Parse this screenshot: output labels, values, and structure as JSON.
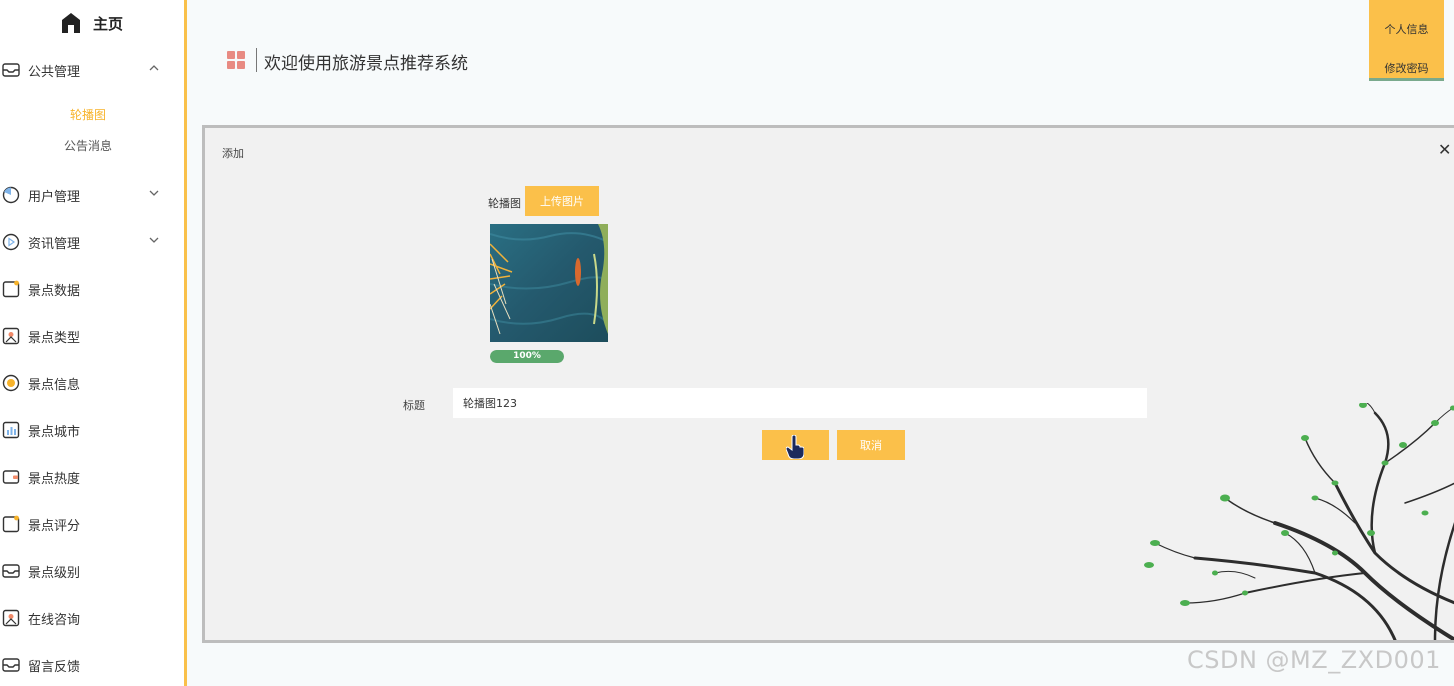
{
  "sidebar": {
    "home_label": "主页",
    "items": [
      {
        "label": "公共管理",
        "expanded": true,
        "icon": "envelope-icon"
      },
      {
        "label": "用户管理",
        "expanded": false,
        "icon": "pie-icon"
      },
      {
        "label": "资讯管理",
        "expanded": false,
        "icon": "play-icon"
      },
      {
        "label": "景点数据",
        "icon": "note-icon"
      },
      {
        "label": "景点类型",
        "icon": "image-icon"
      },
      {
        "label": "景点信息",
        "icon": "coin-icon"
      },
      {
        "label": "景点城市",
        "icon": "bar-chart-icon"
      },
      {
        "label": "景点热度",
        "icon": "wallet-icon"
      },
      {
        "label": "景点评分",
        "icon": "note-icon"
      },
      {
        "label": "景点级别",
        "icon": "envelope-icon"
      },
      {
        "label": "在线咨询",
        "icon": "image-icon"
      },
      {
        "label": "留言反馈",
        "icon": "envelope-icon"
      }
    ],
    "subitems": [
      {
        "label": "轮播图",
        "active": true
      },
      {
        "label": "公告消息",
        "active": false
      }
    ]
  },
  "header": {
    "title": "欢迎使用旅游景点推荐系统",
    "user_menu": {
      "profile": "个人信息",
      "change_password": "修改密码"
    }
  },
  "dialog": {
    "title": "添加",
    "upload_label": "轮播图",
    "upload_button": "上传图片",
    "progress_percent": 100,
    "progress_text": "100%",
    "field_label": "标题",
    "field_value": "轮播图123",
    "confirm_button": "",
    "cancel_button": "取消"
  },
  "watermark": "CSDN @MZ_ZXD001",
  "colors": {
    "accent": "#fbc04a",
    "active_text": "#f7b32b",
    "progress": "#5aa86c",
    "dialog_bg": "#f1f1f1"
  }
}
